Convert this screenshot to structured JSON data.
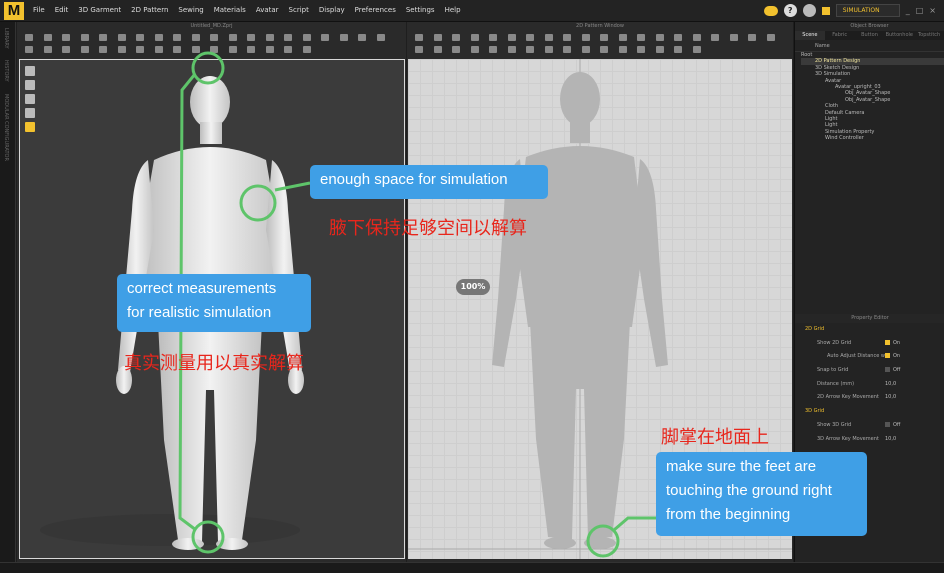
{
  "app": {
    "logo": "M",
    "menu": [
      "File",
      "Edit",
      "3D Garment",
      "2D Pattern",
      "Sewing",
      "Materials",
      "Avatar",
      "Script",
      "Display",
      "Preferences",
      "Settings",
      "Help"
    ],
    "mode": "SIMULATION",
    "help_symbol": "?",
    "window_controls": [
      "_",
      "□",
      "×"
    ]
  },
  "left_strip": [
    "LIBRARY",
    "HISTORY",
    "MODULAR CONFIGURATOR"
  ],
  "window3d": {
    "title": "Untitled_MD.Zprj"
  },
  "window2d": {
    "title": "2D Pattern Window",
    "zoom": "100%"
  },
  "object_browser": {
    "title": "Object Browser",
    "tabs": [
      "Scene",
      "Fabric",
      "Button",
      "Buttonhole",
      "Topstitch"
    ],
    "active_tab": "Scene",
    "column": "Name",
    "tree": [
      "Root",
      "2D Pattern Design",
      "3D Sketch Design",
      "3D Simulation",
      "Avatar",
      "Avatar_upright_03",
      "Obj_Avatar_Shape",
      "Obj_Avatar_Shape",
      "Cloth",
      "Default Camera",
      "Light",
      "Light",
      "Simulation Property",
      "Wind Controller"
    ]
  },
  "property_editor": {
    "title": "Property Editor",
    "rows": [
      {
        "label": "2D Grid",
        "value": ""
      },
      {
        "label": "Show 2D Grid",
        "value": "On"
      },
      {
        "label": "Auto Adjust Distance w",
        "value": "On"
      },
      {
        "label": "Snap to Grid",
        "value": "Off"
      },
      {
        "label": "Distance (mm)",
        "value": "10,0"
      },
      {
        "label": "2D Arrow Key Movement",
        "value": "10,0"
      },
      {
        "label": "3D Grid",
        "value": ""
      },
      {
        "label": "Show 3D Grid",
        "value": "Off"
      },
      {
        "label": "3D Arrow Key Movement",
        "value": "10,0"
      }
    ]
  },
  "annotations": {
    "space_en": "enough space for simulation",
    "space_zh": "腋下保持足够空间以解算",
    "measure_en_1": "correct measurements",
    "measure_en_2": "for realistic simulation",
    "measure_zh": "真实测量用以真实解算",
    "feet_zh": "脚掌在地面上",
    "feet_en_1": "make sure the feet are",
    "feet_en_2": "touching the ground right",
    "feet_en_3": "from the beginning"
  },
  "colors": {
    "accent": "#f2c12e",
    "callout": "#3f9fe6",
    "highlight_green": "#5ec46a",
    "chinese_text": "#e8261c"
  }
}
